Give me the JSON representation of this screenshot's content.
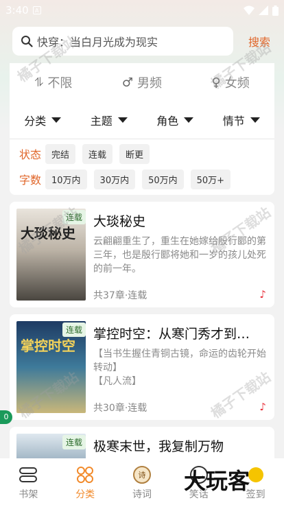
{
  "status_bar": {
    "time": "3:40",
    "a_icon": "A"
  },
  "search": {
    "placeholder": "快穿：当白月光成为现实",
    "button": "搜索"
  },
  "filters": {
    "gender": [
      {
        "icon": "neutral-gender-icon",
        "label": "不限"
      },
      {
        "icon": "male-icon",
        "label": "男频"
      },
      {
        "icon": "female-icon",
        "label": "女频"
      }
    ],
    "dropdowns": [
      "分类",
      "主题",
      "角色",
      "情节"
    ],
    "status_label": "状态",
    "status_tags": [
      "完结",
      "连载",
      "断更"
    ],
    "words_label": "字数",
    "words_tags": [
      "10万内",
      "30万内",
      "50万内",
      "50万+"
    ]
  },
  "books": [
    {
      "title": "大琰秘史",
      "cover_text": "大琰秘史",
      "badge": "连载",
      "description": "云翩翩重生了，重生在她嫁给殷行郾的第三年，也是殷行郾将她和一岁的孩儿处死的前一年。",
      "meta": "共37章·连载"
    },
    {
      "title": "掌控时空：从寒门秀才到…",
      "cover_text": "掌控时空",
      "badge": "连载",
      "description": "【当书生握住青铜古镜，命运的齿轮开始转动】\n【凡人流】",
      "meta": "共30章·连载"
    },
    {
      "title": "极寒末世，我复制万物",
      "cover_text": "",
      "badge": "连载",
      "description": "",
      "meta": ""
    }
  ],
  "side_badge": "0",
  "tabs": [
    {
      "label": "书架",
      "icon": "bookshelf-icon"
    },
    {
      "label": "分类",
      "icon": "category-icon"
    },
    {
      "label": "诗词",
      "icon": "poem-icon"
    },
    {
      "label": "笑话",
      "icon": "smile-icon"
    },
    {
      "label": "签到",
      "icon": "sign-in-icon"
    }
  ],
  "watermark_text": "橘子下载站",
  "logo_text": "大玩客",
  "colors": {
    "accent": "#e0662a",
    "active_tab": "#f28a2a",
    "badge_green": "#1a9a5a"
  }
}
